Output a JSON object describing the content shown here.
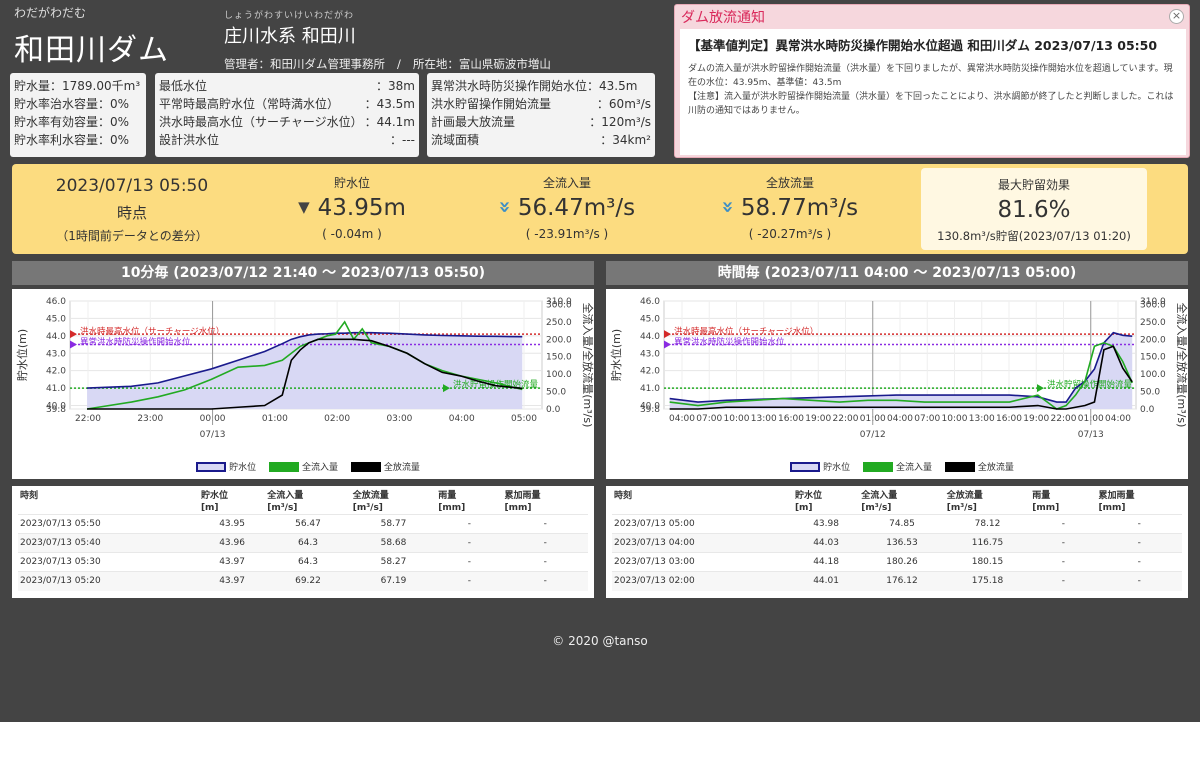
{
  "dam": {
    "kana": "わだがわだむ",
    "name": "和田川ダム"
  },
  "river": {
    "kana": "しょうがわすいけいわだがわ",
    "name": "庄川水系 和田川",
    "manager_label": "管理者：和田川ダム管理事務所",
    "separator": "/",
    "location_label": "所在地：富山県砺波市増山"
  },
  "storage_info": [
    {
      "label": "貯水量：1789.00千m³",
      "value": ""
    },
    {
      "label": "貯水率治水容量：0%",
      "value": ""
    },
    {
      "label": "貯水率有効容量：0%",
      "value": ""
    },
    {
      "label": "貯水率利水容量：0%",
      "value": ""
    }
  ],
  "level_info": [
    {
      "label": "最低水位",
      "value": "：38m"
    },
    {
      "label": "平常時最高貯水位（常時満水位）",
      "value": "：43.5m"
    },
    {
      "label": "洪水時最高水位（サーチャージ水位）",
      "value": "：44.1m"
    },
    {
      "label": "設計洪水位",
      "value": "：---"
    }
  ],
  "flood_info": [
    {
      "label": "異常洪水時防災操作開始水位：43.5m",
      "value": ""
    },
    {
      "label": "洪水貯留操作開始流量",
      "value": "：60m³/s"
    },
    {
      "label": "計画最大放流量",
      "value": "：120m³/s"
    },
    {
      "label": "流域面積",
      "value": "：34km²"
    }
  ],
  "notice": {
    "title": "ダム放流通知",
    "close": "×",
    "headline": "【基準値判定】異常洪水時防災操作開始水位超過 和田川ダム 2023/07/13 05:50",
    "line1": "ダムの流入量が洪水貯留操作開始流量（洪水量）を下回りましたが、異常洪水時防災操作開始水位を超過しています。現在の水位：43.95m、基準値：43.5m",
    "line2": "【注意】流入量が洪水貯留操作開始流量（洪水量）を下回ったことにより、洪水調節が終了したと判断しました。これは川防の通知ではありません。"
  },
  "summary": {
    "time": "2023/07/13 05:50",
    "time_suffix": "時点",
    "diff_note": "（1時間前データとの差分）",
    "level": {
      "label": "貯水位",
      "arrow": "▼",
      "value": "43.95m",
      "diff": "( -0.04m )"
    },
    "inflow": {
      "label": "全流入量",
      "arrow": "»",
      "value": "56.47m³/s",
      "diff": "( -23.91m³/s )"
    },
    "outflow": {
      "label": "全放流量",
      "arrow": "»",
      "value": "58.77m³/s",
      "diff": "( -20.27m³/s )"
    },
    "effect": {
      "label": "最大貯留効果",
      "value": "81.6%",
      "sub": "130.8m³/s貯留(2023/07/13 01:20)"
    }
  },
  "panels": {
    "left_title": "10分毎 (2023/07/12 21:40 ～ 2023/07/13 05:50)",
    "right_title": "時間毎 (2023/07/11 04:00 ～ 2023/07/13 05:00)"
  },
  "legend": {
    "level": "貯水位",
    "inflow": "全流入量",
    "outflow": "全放流量"
  },
  "colors": {
    "level": "#1a1a8c",
    "level_fill": "#d8d8f4",
    "inflow": "#22aa22",
    "outflow": "#000000",
    "surcharge": "#d42a2a",
    "flood_start": "#8a2be2",
    "flood_q": "#22aa22"
  },
  "table": {
    "headers": [
      "時刻",
      "貯水位\n[m]",
      "全流入量\n[m³/s]",
      "全放流量\n[m³/s]",
      "雨量\n[mm]",
      "累加雨量\n[mm]"
    ],
    "left_rows": [
      [
        "2023/07/13 05:50",
        "43.95",
        "56.47",
        "58.77",
        "-",
        "-"
      ],
      [
        "2023/07/13 05:40",
        "43.96",
        "64.3",
        "58.68",
        "-",
        "-"
      ],
      [
        "2023/07/13 05:30",
        "43.97",
        "64.3",
        "58.27",
        "-",
        "-"
      ],
      [
        "2023/07/13 05:20",
        "43.97",
        "69.22",
        "67.19",
        "-",
        "-"
      ]
    ],
    "right_rows": [
      [
        "2023/07/13 05:00",
        "43.98",
        "74.85",
        "78.12",
        "-",
        "-"
      ],
      [
        "2023/07/13 04:00",
        "44.03",
        "136.53",
        "116.75",
        "-",
        "-"
      ],
      [
        "2023/07/13 03:00",
        "44.18",
        "180.26",
        "180.15",
        "-",
        "-"
      ],
      [
        "2023/07/13 02:00",
        "44.01",
        "176.12",
        "175.18",
        "-",
        "-"
      ]
    ]
  },
  "chart_data": [
    {
      "type": "line",
      "title": "10分毎 (2023/07/12 21:40 ～ 2023/07/13 05:50)",
      "ylabel": "貯水位(m)",
      "y2label": "全流入量/全放流量(m³/s)",
      "ylim": [
        39.8,
        46.0
      ],
      "y2lim": [
        0,
        310
      ],
      "yticks": [
        "46.0",
        "45.0",
        "44.0",
        "43.0",
        "42.0",
        "41.0",
        "40.0",
        "39.8"
      ],
      "y2ticks": [
        "310.0",
        "300.0",
        "250.0",
        "200.0",
        "150.0",
        "100.0",
        "50.0",
        "0.0"
      ],
      "xticks": [
        "22:00",
        "23:00",
        "00:00",
        "01:00",
        "02:00",
        "03:00",
        "04:00",
        "05:00"
      ],
      "xdate": "07/13",
      "ref_lines": [
        {
          "name": "洪水時最高水位（サーチャージ水位）",
          "axis": "y",
          "value": 44.1
        },
        {
          "name": "異常洪水時防災操作開始水位",
          "axis": "y",
          "value": 43.5
        },
        {
          "name": "洪水貯留操作開始流量",
          "axis": "y2",
          "value": 60
        }
      ],
      "x_hours": [
        -2.33,
        -1.5,
        -1.0,
        -0.5,
        0.0,
        0.5,
        1.0,
        1.33,
        1.5,
        1.67,
        1.83,
        2.0,
        2.17,
        2.33,
        2.5,
        2.67,
        2.83,
        3.0,
        3.33,
        3.67,
        4.0,
        4.33,
        4.67,
        5.0,
        5.33,
        5.83
      ],
      "series": [
        {
          "name": "貯水位",
          "values": [
            41.0,
            41.1,
            41.3,
            41.7,
            42.1,
            42.6,
            43.1,
            43.55,
            43.8,
            43.95,
            44.05,
            44.1,
            44.12,
            44.15,
            44.15,
            44.18,
            44.18,
            44.18,
            44.15,
            44.1,
            44.05,
            44.02,
            44.0,
            43.98,
            43.97,
            43.95
          ]
        },
        {
          "name": "全流入量",
          "values": [
            0,
            20,
            35,
            55,
            85,
            120,
            125,
            140,
            160,
            180,
            190,
            200,
            210,
            215,
            250,
            200,
            230,
            190,
            180,
            160,
            130,
            110,
            95,
            85,
            75,
            56
          ]
        },
        {
          "name": "全放流量",
          "values": [
            0,
            0,
            0,
            0,
            0,
            5,
            10,
            40,
            140,
            170,
            190,
            200,
            200,
            200,
            200,
            200,
            198,
            196,
            180,
            160,
            130,
            105,
            95,
            80,
            67,
            59
          ]
        }
      ]
    },
    {
      "type": "line",
      "title": "時間毎 (2023/07/11 04:00 ～ 2023/07/13 05:00)",
      "ylabel": "貯水位(m)",
      "y2label": "全流入量/全放流量(m³/s)",
      "ylim": [
        39.8,
        46.0
      ],
      "y2lim": [
        0,
        310
      ],
      "yticks": [
        "46.0",
        "45.0",
        "44.0",
        "43.0",
        "42.0",
        "41.0",
        "40.0",
        "39.8"
      ],
      "y2ticks": [
        "310.0",
        "300.0",
        "250.0",
        "200.0",
        "150.0",
        "100.0",
        "50.0",
        "0.0"
      ],
      "xticks": [
        "04:00",
        "07:00",
        "10:00",
        "13:00",
        "16:00",
        "19:00",
        "22:00",
        "01:00",
        "04:00",
        "07:00",
        "10:00",
        "13:00",
        "16:00",
        "19:00",
        "22:00",
        "01:00",
        "04:00"
      ],
      "xdate_labels": [
        "07/12",
        "07/13"
      ],
      "ref_lines": [
        {
          "name": "洪水時最高水位（サーチャージ水位）",
          "axis": "y",
          "value": 44.1
        },
        {
          "name": "異常洪水時防災操作開始水位",
          "axis": "y",
          "value": 43.5
        },
        {
          "name": "洪水貯留操作開始流量",
          "axis": "y2",
          "value": 60
        }
      ],
      "x_hours": [
        0,
        3,
        6,
        9,
        12,
        15,
        18,
        21,
        24,
        27,
        30,
        33,
        36,
        39,
        41,
        42,
        43,
        44,
        45,
        46,
        47,
        48,
        49
      ],
      "series": [
        {
          "name": "貯水位",
          "values": [
            40.4,
            40.2,
            40.3,
            40.35,
            40.4,
            40.45,
            40.5,
            40.55,
            40.6,
            40.6,
            40.6,
            40.6,
            40.6,
            40.5,
            40.2,
            40.2,
            41.0,
            41.4,
            42.1,
            43.6,
            44.18,
            44.03,
            43.98
          ]
        },
        {
          "name": "全流入量",
          "values": [
            20,
            10,
            20,
            25,
            30,
            25,
            20,
            25,
            25,
            20,
            20,
            20,
            20,
            40,
            0,
            10,
            40,
            80,
            180,
            190,
            180,
            136,
            75
          ]
        },
        {
          "name": "全放流量",
          "values": [
            0,
            0,
            5,
            5,
            5,
            5,
            5,
            5,
            5,
            5,
            5,
            5,
            5,
            10,
            0,
            0,
            5,
            10,
            20,
            170,
            180,
            117,
            78
          ]
        }
      ]
    }
  ],
  "footer": "© 2020 @tanso"
}
